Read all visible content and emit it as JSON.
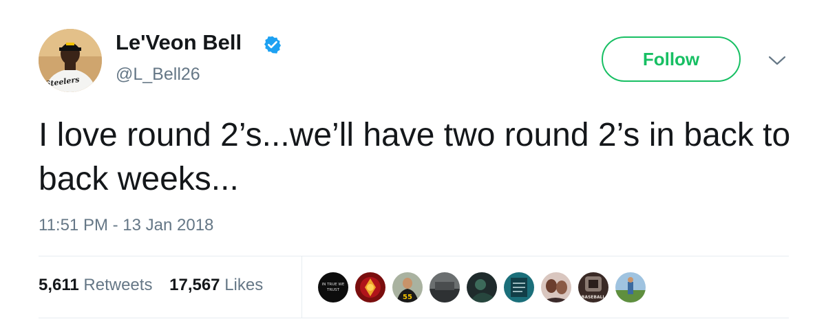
{
  "tweet": {
    "author": {
      "display_name": "Le'Veon Bell",
      "handle": "@L_Bell26",
      "verified": true,
      "avatar_label": "Steelers"
    },
    "follow_button_label": "Follow",
    "text": "I love round 2’s...we’ll have two round 2’s in back to back weeks...",
    "timestamp": "11:51 PM - 13 Jan 2018",
    "stats": {
      "retweets_count": "5,611",
      "retweets_label": "Retweets",
      "likes_count": "17,567",
      "likes_label": "Likes"
    },
    "liker_avatars": [
      {
        "name": "liker-avatar-1",
        "text_line1": "IN TRUE WE",
        "text_line2": "TRUST"
      },
      {
        "name": "liker-avatar-2"
      },
      {
        "name": "liker-avatar-3",
        "jersey_number": "55"
      },
      {
        "name": "liker-avatar-4"
      },
      {
        "name": "liker-avatar-5"
      },
      {
        "name": "liker-avatar-6"
      },
      {
        "name": "liker-avatar-7"
      },
      {
        "name": "liker-avatar-8",
        "text": "BASEBALL"
      },
      {
        "name": "liker-avatar-9"
      }
    ]
  },
  "colors": {
    "follow_green": "#17bf63",
    "verified_blue": "#1da1f2",
    "secondary_text": "#657786",
    "primary_text": "#14171a",
    "divider": "#e6ecf0"
  }
}
